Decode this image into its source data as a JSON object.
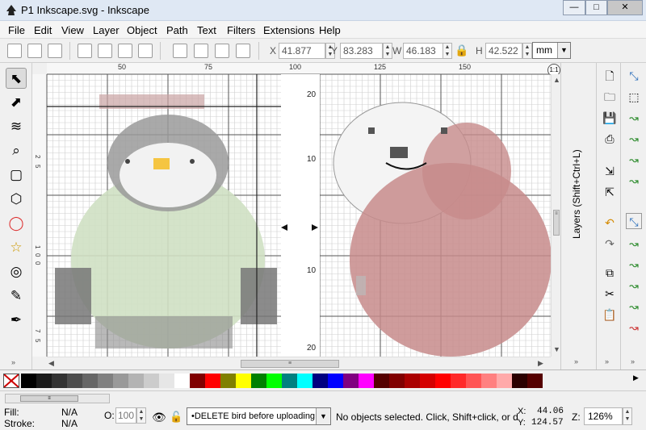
{
  "window": {
    "title": "P1 Inkscape.svg - Inkscape",
    "minimize": "—",
    "maximize": "□",
    "close": "✕"
  },
  "menu": [
    "File",
    "Edit",
    "View",
    "Layer",
    "Object",
    "Path",
    "Text",
    "Filters",
    "Extensions",
    "Help"
  ],
  "toolbar": {
    "x_label": "X",
    "x_value": "41.877",
    "y_label": "Y",
    "y_value": "83.283",
    "w_label": "W",
    "w_value": "46.183",
    "h_label": "H",
    "h_value": "42.522",
    "unit": "mm"
  },
  "ruler": {
    "h_ticks": [
      "50",
      "75",
      "100",
      "125",
      "150"
    ],
    "v_ticks": [
      "2",
      "5",
      "1",
      "0",
      "0",
      "7",
      "5"
    ]
  },
  "canvas": {
    "right_labels": [
      "20",
      "10",
      "10",
      "20"
    ],
    "right_label_tops": [
      0,
      0,
      0,
      0
    ]
  },
  "dock": {
    "layers_tab": "Layers (Shift+Ctrl+L)"
  },
  "tools": [
    {
      "name": "selector-tool-icon",
      "glyph": "⬉"
    },
    {
      "name": "node-tool-icon",
      "glyph": "⬈"
    },
    {
      "name": "tweak-tool-icon",
      "glyph": "≋"
    },
    {
      "name": "zoom-tool-icon",
      "glyph": "⌕"
    },
    {
      "name": "rectangle-tool-icon",
      "glyph": "▢"
    },
    {
      "name": "3d-box-tool-icon",
      "glyph": "⬡"
    },
    {
      "name": "ellipse-tool-icon",
      "glyph": "◯"
    },
    {
      "name": "star-tool-icon",
      "glyph": "☆"
    },
    {
      "name": "spiral-tool-icon",
      "glyph": "◎"
    },
    {
      "name": "pencil-tool-icon",
      "glyph": "✎"
    },
    {
      "name": "pen-tool-icon",
      "glyph": "✒"
    }
  ],
  "palette": [
    "#000000",
    "#1a1a1a",
    "#333333",
    "#4d4d4d",
    "#666666",
    "#808080",
    "#999999",
    "#b3b3b3",
    "#cccccc",
    "#e6e6e6",
    "#ffffff",
    "#800000",
    "#ff0000",
    "#808000",
    "#ffff00",
    "#008000",
    "#00ff00",
    "#008080",
    "#00ffff",
    "#000080",
    "#0000ff",
    "#800080",
    "#ff00ff",
    "#550000",
    "#800000",
    "#aa0000",
    "#d40000",
    "#ff0000",
    "#ff2a2a",
    "#ff5555",
    "#ff8080",
    "#ffaaaa",
    "#2b0000",
    "#550000"
  ],
  "status": {
    "fill_label": "Fill:",
    "fill_value": "N/A",
    "stroke_label": "Stroke:",
    "stroke_value": "N/A",
    "opacity_label": "O:",
    "opacity_value": "100",
    "layer": "•DELETE bird before uploading",
    "message": "No objects selected. Click, Shift+click, or d",
    "x_label": "X:",
    "x_value": "44.06",
    "y_label": "Y:",
    "y_value": "124.57",
    "zoom_label": "Z:",
    "zoom_value": "126%"
  }
}
